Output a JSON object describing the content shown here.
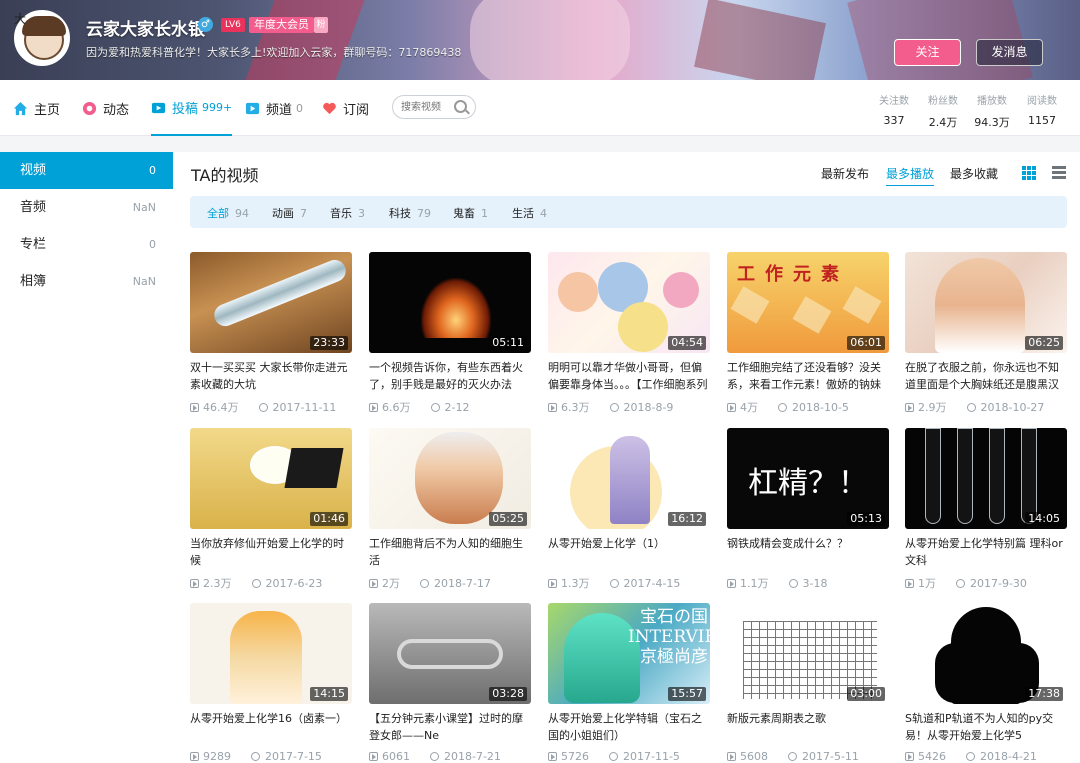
{
  "profile": {
    "name": "云家大家长水银",
    "level": "LV6",
    "vip": "年度大会员",
    "vip_badge": "粉",
    "avatar_badge": "大",
    "signature": "因为爱和热爱科普化学！大家长多上!欢迎加入云家，群聊号码：717869438",
    "follow_button": "关注",
    "message_button": "发消息"
  },
  "nav": {
    "items": [
      {
        "label": "主页",
        "count": ""
      },
      {
        "label": "动态",
        "count": ""
      },
      {
        "label": "投稿",
        "count": "999+"
      },
      {
        "label": "频道",
        "count": "0"
      },
      {
        "label": "订阅",
        "count": ""
      }
    ],
    "search_placeholder": "搜索视频",
    "stats": [
      {
        "label": "关注数",
        "value": "337"
      },
      {
        "label": "粉丝数",
        "value": "2.4万"
      },
      {
        "label": "播放数",
        "value": "94.3万"
      },
      {
        "label": "阅读数",
        "value": "1157"
      }
    ]
  },
  "sidebar": {
    "items": [
      {
        "label": "视频",
        "count": "0"
      },
      {
        "label": "音频",
        "count": "NaN"
      },
      {
        "label": "专栏",
        "count": "0"
      },
      {
        "label": "相簿",
        "count": "NaN"
      }
    ]
  },
  "main": {
    "title": "TA的视频",
    "sort": [
      "最新发布",
      "最多播放",
      "最多收藏"
    ],
    "filters": [
      {
        "label": "全部",
        "count": "94"
      },
      {
        "label": "动画",
        "count": "7"
      },
      {
        "label": "音乐",
        "count": "3"
      },
      {
        "label": "科技",
        "count": "79"
      },
      {
        "label": "鬼畜",
        "count": "1"
      },
      {
        "label": "生活",
        "count": "4"
      }
    ],
    "videos": [
      {
        "title": "双十一买买买 大家长带你走进元素收藏的大坑",
        "duration": "23:33",
        "plays": "46.4万",
        "date": "2017-11-11"
      },
      {
        "title": "一个视频告诉你，有些东西着火了，别手贱是最好的灭火办法（五",
        "duration": "05:11",
        "plays": "6.6万",
        "date": "2-12"
      },
      {
        "title": "明明可以靠才华做小哥哥，但偏偏要靠身体当。。。【工作细胞系列",
        "duration": "04:54",
        "plays": "6.3万",
        "date": "2018-8-9"
      },
      {
        "title": "工作细胞完结了还没看够？没关系，来看工作元素！傲娇的钠妹子",
        "duration": "06:01",
        "plays": "4万",
        "date": "2018-10-5"
      },
      {
        "title": "在脱了衣服之前，你永远也不知道里面是个大胸妹纸还是腹黑汉砸！",
        "duration": "06:25",
        "plays": "2.9万",
        "date": "2018-10-27"
      },
      {
        "title": "当你放弃修仙开始爱上化学的时候",
        "duration": "01:46",
        "plays": "2.3万",
        "date": "2017-6-23"
      },
      {
        "title": "工作细胞背后不为人知的细胞生活",
        "duration": "05:25",
        "plays": "2万",
        "date": "2018-7-17"
      },
      {
        "title": "从零开始爱上化学（1）",
        "duration": "16:12",
        "plays": "1.3万",
        "date": "2017-4-15"
      },
      {
        "title": "钢铁成精会变成什么？？",
        "duration": "05:13",
        "plays": "1.1万",
        "date": "3-18"
      },
      {
        "title": "从零开始爱上化学特别篇 理科or文科",
        "duration": "14:05",
        "plays": "1万",
        "date": "2017-9-30"
      },
      {
        "title": "从零开始爱上化学16（卤素一）",
        "duration": "14:15",
        "plays": "9289",
        "date": "2017-7-15"
      },
      {
        "title": "【五分钟元素小课堂】过时的摩登女郎——Ne",
        "duration": "03:28",
        "plays": "6061",
        "date": "2018-7-21"
      },
      {
        "title": "从零开始爱上化学特辑（宝石之国的小姐姐们）",
        "duration": "15:57",
        "plays": "5726",
        "date": "2017-11-5"
      },
      {
        "title": "新版元素周期表之歌",
        "duration": "03:00",
        "plays": "5608",
        "date": "2017-5-11"
      },
      {
        "title": "S轨道和P轨道不为人知的py交易！从零开始爱上化学5",
        "duration": "17:38",
        "plays": "5426",
        "date": "2018-4-21"
      }
    ],
    "thumb_text": {
      "v4": "工作元素",
      "v9": "杠精？！",
      "v13": "宝石の国 INTERVIEW 京極尚彦"
    }
  },
  "colors": {
    "accent": "#00a1d6",
    "pink": "#f25d8e"
  }
}
